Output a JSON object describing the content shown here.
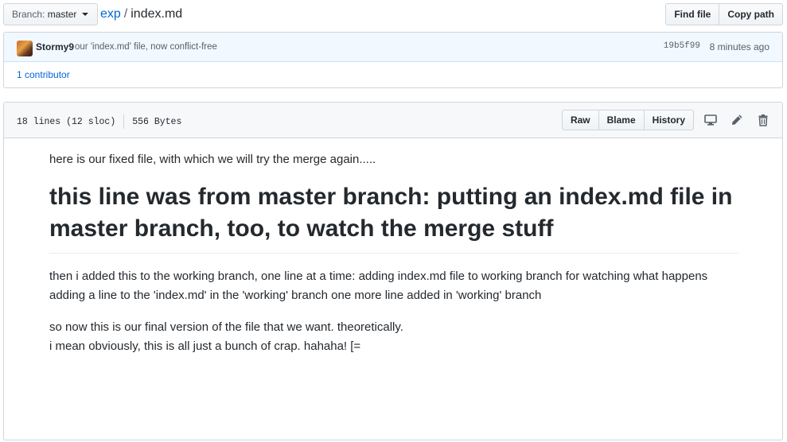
{
  "topbar": {
    "branch_prefix": "Branch:",
    "branch_name": "master",
    "breadcrumb_repo": "exp",
    "breadcrumb_sep": "/",
    "breadcrumb_file": "index.md",
    "find_file": "Find file",
    "copy_path": "Copy path"
  },
  "commit": {
    "author": "Stormy9",
    "message": "our 'index.md' file, now conflict-free",
    "sha": "19b5f99",
    "time": "8 minutes ago",
    "contributors": "1 contributor"
  },
  "file": {
    "lines": "18 lines (12 sloc)",
    "size": "556 Bytes",
    "actions": {
      "raw": "Raw",
      "blame": "Blame",
      "history": "History"
    },
    "icons": [
      "desktop-icon",
      "pencil-icon",
      "trash-icon"
    ]
  },
  "content": {
    "p1": "here is our fixed file, with which we will try the merge again.....",
    "h1": "this line was from master branch: putting an index.md file in master branch, too, to watch the merge stuff",
    "p2": "then i added this to the working branch, one line at a time: adding index.md file to working branch for watching what happens adding a line to the 'index.md' in the 'working' branch one more line added in 'working' branch",
    "p3_line1": "so now this is our final version of the file that we want. theoretically.",
    "p3_line2": "i mean obviously, this is all just a bunch of crap. hahaha! [="
  },
  "colors": {
    "link": "#0366d6",
    "commit_bg": "#f1f8ff",
    "header_bg": "#f6f8fa",
    "border": "#d1d5da"
  }
}
